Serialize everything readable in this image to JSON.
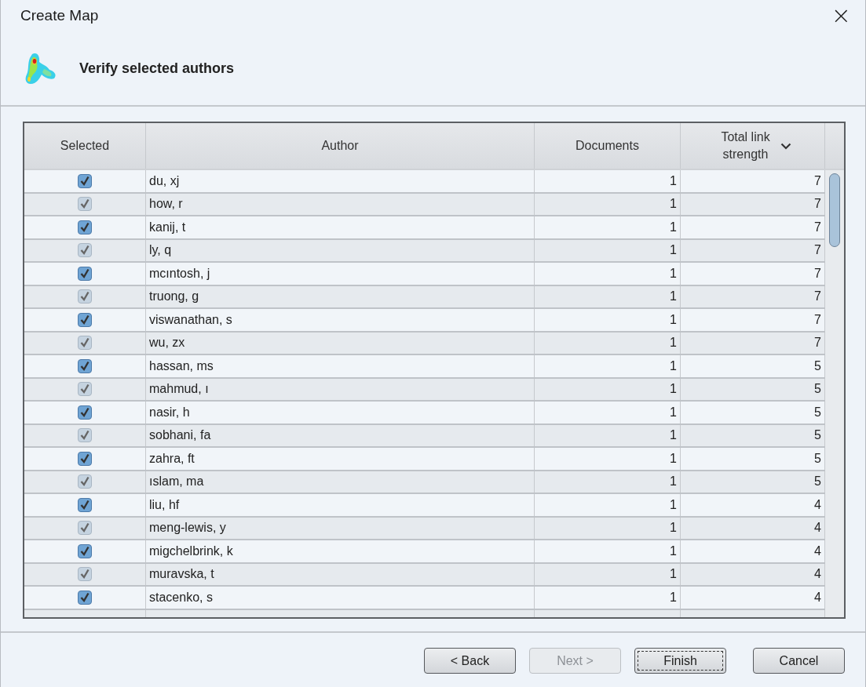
{
  "window": {
    "title": "Create Map",
    "close": "×"
  },
  "heading": "Verify selected authors",
  "table": {
    "columns": [
      "Selected",
      "Author",
      "Documents",
      "Total link strength"
    ],
    "sorted_descending": true,
    "rows": [
      {
        "checked": true,
        "author": "du, xj",
        "documents": "1",
        "total_link_strength": "7"
      },
      {
        "checked": true,
        "author": "how, r",
        "documents": "1",
        "total_link_strength": "7"
      },
      {
        "checked": true,
        "author": "kanij, t",
        "documents": "1",
        "total_link_strength": "7"
      },
      {
        "checked": true,
        "author": "ly, q",
        "documents": "1",
        "total_link_strength": "7"
      },
      {
        "checked": true,
        "author": "mcıntosh, j",
        "documents": "1",
        "total_link_strength": "7"
      },
      {
        "checked": true,
        "author": "truong, g",
        "documents": "1",
        "total_link_strength": "7"
      },
      {
        "checked": true,
        "author": "viswanathan, s",
        "documents": "1",
        "total_link_strength": "7"
      },
      {
        "checked": true,
        "author": "wu, zx",
        "documents": "1",
        "total_link_strength": "7"
      },
      {
        "checked": true,
        "author": "hassan, ms",
        "documents": "1",
        "total_link_strength": "5"
      },
      {
        "checked": true,
        "author": "mahmud, ı",
        "documents": "1",
        "total_link_strength": "5"
      },
      {
        "checked": true,
        "author": "nasir, h",
        "documents": "1",
        "total_link_strength": "5"
      },
      {
        "checked": true,
        "author": "sobhani, fa",
        "documents": "1",
        "total_link_strength": "5"
      },
      {
        "checked": true,
        "author": "zahra, ft",
        "documents": "1",
        "total_link_strength": "5"
      },
      {
        "checked": true,
        "author": "ıslam, ma",
        "documents": "1",
        "total_link_strength": "5"
      },
      {
        "checked": true,
        "author": "liu, hf",
        "documents": "1",
        "total_link_strength": "4"
      },
      {
        "checked": true,
        "author": "meng-lewis, y",
        "documents": "1",
        "total_link_strength": "4"
      },
      {
        "checked": true,
        "author": "migchelbrink, k",
        "documents": "1",
        "total_link_strength": "4"
      },
      {
        "checked": true,
        "author": "muravska, t",
        "documents": "1",
        "total_link_strength": "4"
      },
      {
        "checked": true,
        "author": "stacenko, s",
        "documents": "1",
        "total_link_strength": "4"
      }
    ]
  },
  "buttons": [
    {
      "label": "< Back",
      "disabled": false,
      "focused": false
    },
    {
      "label": "Next >",
      "disabled": true,
      "focused": false
    },
    {
      "label": "Finish",
      "disabled": false,
      "focused": true
    },
    {
      "label": "Cancel",
      "disabled": false,
      "focused": false
    }
  ]
}
